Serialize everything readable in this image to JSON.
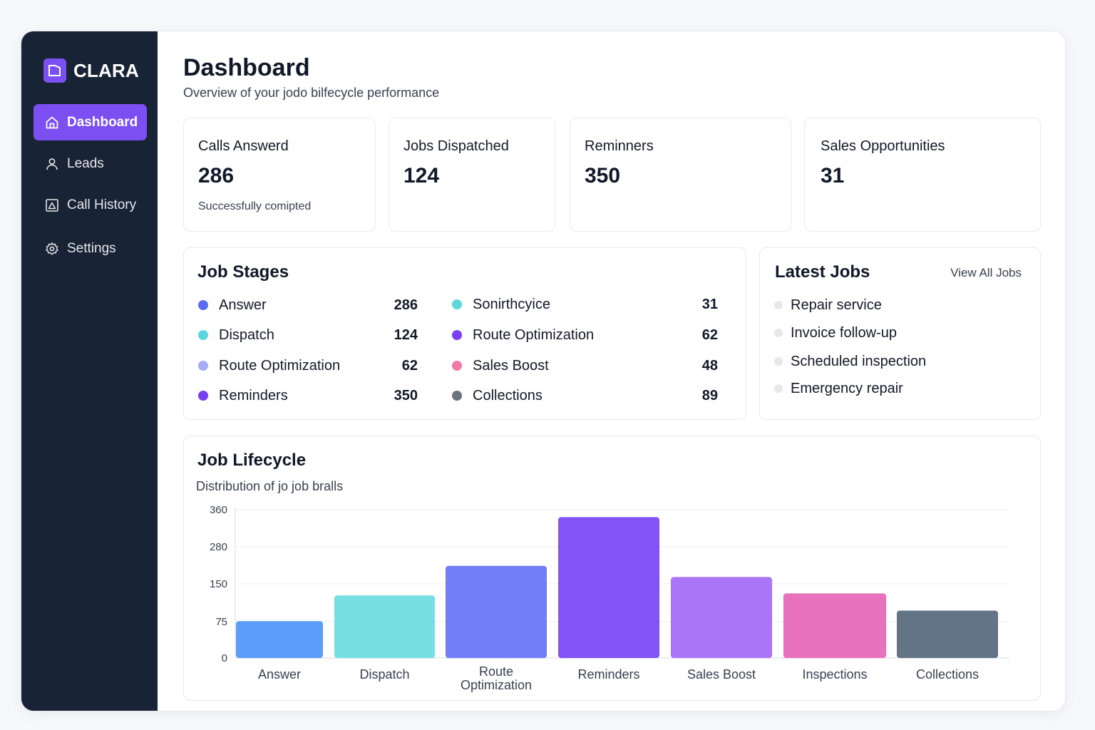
{
  "app": {
    "name": "CLARA"
  },
  "sidebar": {
    "items": [
      {
        "label": "Dashboard",
        "icon": "home-icon",
        "active": true
      },
      {
        "label": "Leads",
        "icon": "user-icon",
        "active": false
      },
      {
        "label": "Call History",
        "icon": "chart-icon",
        "active": false
      },
      {
        "label": "Settings",
        "icon": "gear-icon",
        "active": false
      }
    ]
  },
  "header": {
    "title": "Dashboard",
    "subtitle": "Overview of your jodo bilfecycle performance"
  },
  "stats": [
    {
      "label": "Calls Answerd",
      "value": "286",
      "note": "Successfully comipted"
    },
    {
      "label": "Jobs Dispatched",
      "value": "124",
      "note": ""
    },
    {
      "label": "Reminners",
      "value": "350",
      "note": ""
    },
    {
      "label": "Sales Opportunities",
      "value": "31",
      "note": ""
    }
  ],
  "job_stages": {
    "title": "Job Stages",
    "left": [
      {
        "name": "Answer",
        "value": "286",
        "color": "#5b6cf0"
      },
      {
        "name": "Dispatch",
        "value": "124",
        "color": "#5fd6dc"
      },
      {
        "name": "Route Optimization",
        "value": "62",
        "color": "#a5acf5"
      },
      {
        "name": "Reminders",
        "value": "350",
        "color": "#7a3ff0"
      }
    ],
    "right": [
      {
        "name": "Sonirthcyice",
        "value": "31",
        "color": "#5fd6dc"
      },
      {
        "name": "Route Optimization",
        "value": "62",
        "color": "#7a3ff0"
      },
      {
        "name": "Sales Boost",
        "value": "48",
        "color": "#f07aa8"
      },
      {
        "name": "Collections",
        "value": "89",
        "color": "#6b7280"
      }
    ]
  },
  "latest_jobs": {
    "title": "Latest Jobs",
    "view_all_label": "View All Jobs",
    "items": [
      "Repair service",
      "Invoice follow-up",
      "Scheduled inspection",
      "Emergency repair"
    ]
  },
  "lifecycle": {
    "title": "Job Lifecycle",
    "subtitle": "Distribution of jo job bralls"
  },
  "chart_data": {
    "type": "bar",
    "title": "Job Lifecycle",
    "subtitle": "Distribution of jo job bralls",
    "categories": [
      "Answer",
      "Dispatch",
      "Route Optimization",
      "Reminders",
      "Sales Boost",
      "Inspections",
      "Collections"
    ],
    "category_lines": [
      [
        "Answer"
      ],
      [
        "Dispatch"
      ],
      [
        "Route",
        "Optimization"
      ],
      [
        "Reminders"
      ],
      [
        "Sales Boost"
      ],
      [
        "Inspections"
      ],
      [
        "Collections"
      ]
    ],
    "values": [
      76,
      127,
      213,
      344,
      174,
      131,
      97
    ],
    "y_ticks": [
      0,
      75,
      150,
      280,
      360
    ],
    "ylim": [
      0,
      360
    ],
    "colors": [
      "#5b9df8",
      "#76dfe4",
      "#727ef7",
      "#8453f7",
      "#aa76f7",
      "#e872be",
      "#637487"
    ],
    "grid": true,
    "xlabel": "",
    "ylabel": ""
  }
}
